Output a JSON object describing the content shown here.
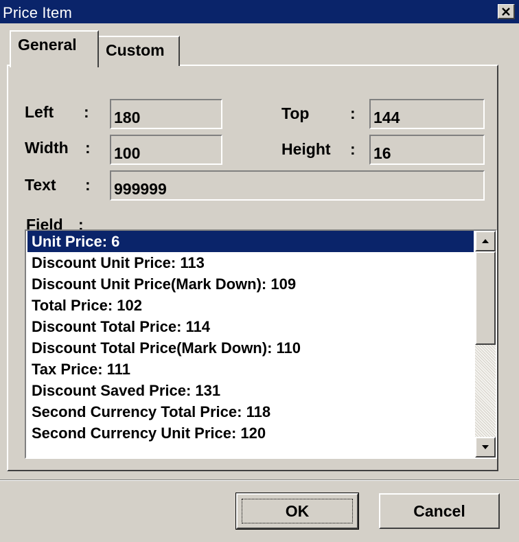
{
  "window": {
    "title": "Price Item"
  },
  "tabs": [
    {
      "label": "General",
      "active": true
    },
    {
      "label": "Custom",
      "active": false
    }
  ],
  "form": {
    "left": {
      "label": "Left",
      "value": "180"
    },
    "top": {
      "label": "Top",
      "value": "144"
    },
    "width": {
      "label": "Width",
      "value": "100"
    },
    "height": {
      "label": "Height",
      "value": "16"
    },
    "text": {
      "label": "Text",
      "value": "999999"
    },
    "field_label": "Field",
    "separator": ":"
  },
  "field_list": {
    "items": [
      "Unit Price: 6",
      "Discount Unit Price: 113",
      "Discount Unit Price(Mark Down): 109",
      "Total Price: 102",
      "Discount Total Price: 114",
      "Discount Total Price(Mark Down): 110",
      "Tax Price: 111",
      "Discount Saved Price: 131",
      "Second Currency Total Price: 118",
      "Second Currency Unit Price: 120"
    ],
    "selected_index": 0
  },
  "buttons": {
    "ok": "OK",
    "cancel": "Cancel"
  },
  "icons": {
    "close": "close-icon",
    "scroll_up": "arrow-up-icon",
    "scroll_down": "arrow-down-icon"
  },
  "colors": {
    "titlebar": "#0a246a",
    "dialog_bg": "#d4d0c8",
    "selection": "#0a246a",
    "list_bg": "#ffffff"
  }
}
